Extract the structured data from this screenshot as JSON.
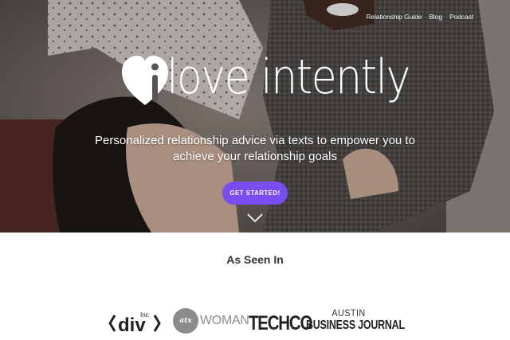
{
  "nav": {
    "items": [
      {
        "label": "Relationship Guide"
      },
      {
        "label": "Blog"
      },
      {
        "label": "Podcast"
      }
    ]
  },
  "brand": {
    "logo_text": "love intently",
    "logo_icon": "heart-i-icon"
  },
  "hero": {
    "tagline": "Personalized relationship advice via texts to empower you to achieve your relationship goals",
    "cta_label": "GET STARTED!",
    "scroll_icon": "chevron-down-icon"
  },
  "press": {
    "title": "As Seen In",
    "logos": {
      "divinc_main": "div",
      "divinc_sup": "Inc",
      "atx_mark": "atx",
      "atx_word": "WOMAN",
      "techco": "TECHCO",
      "abj_top": "AUSTIN",
      "abj_bottom": "BUSINESS JOURNAL"
    }
  },
  "colors": {
    "accent": "#7b4cf0",
    "hero_overlay": "#5f5955",
    "text_dark": "#333333"
  }
}
